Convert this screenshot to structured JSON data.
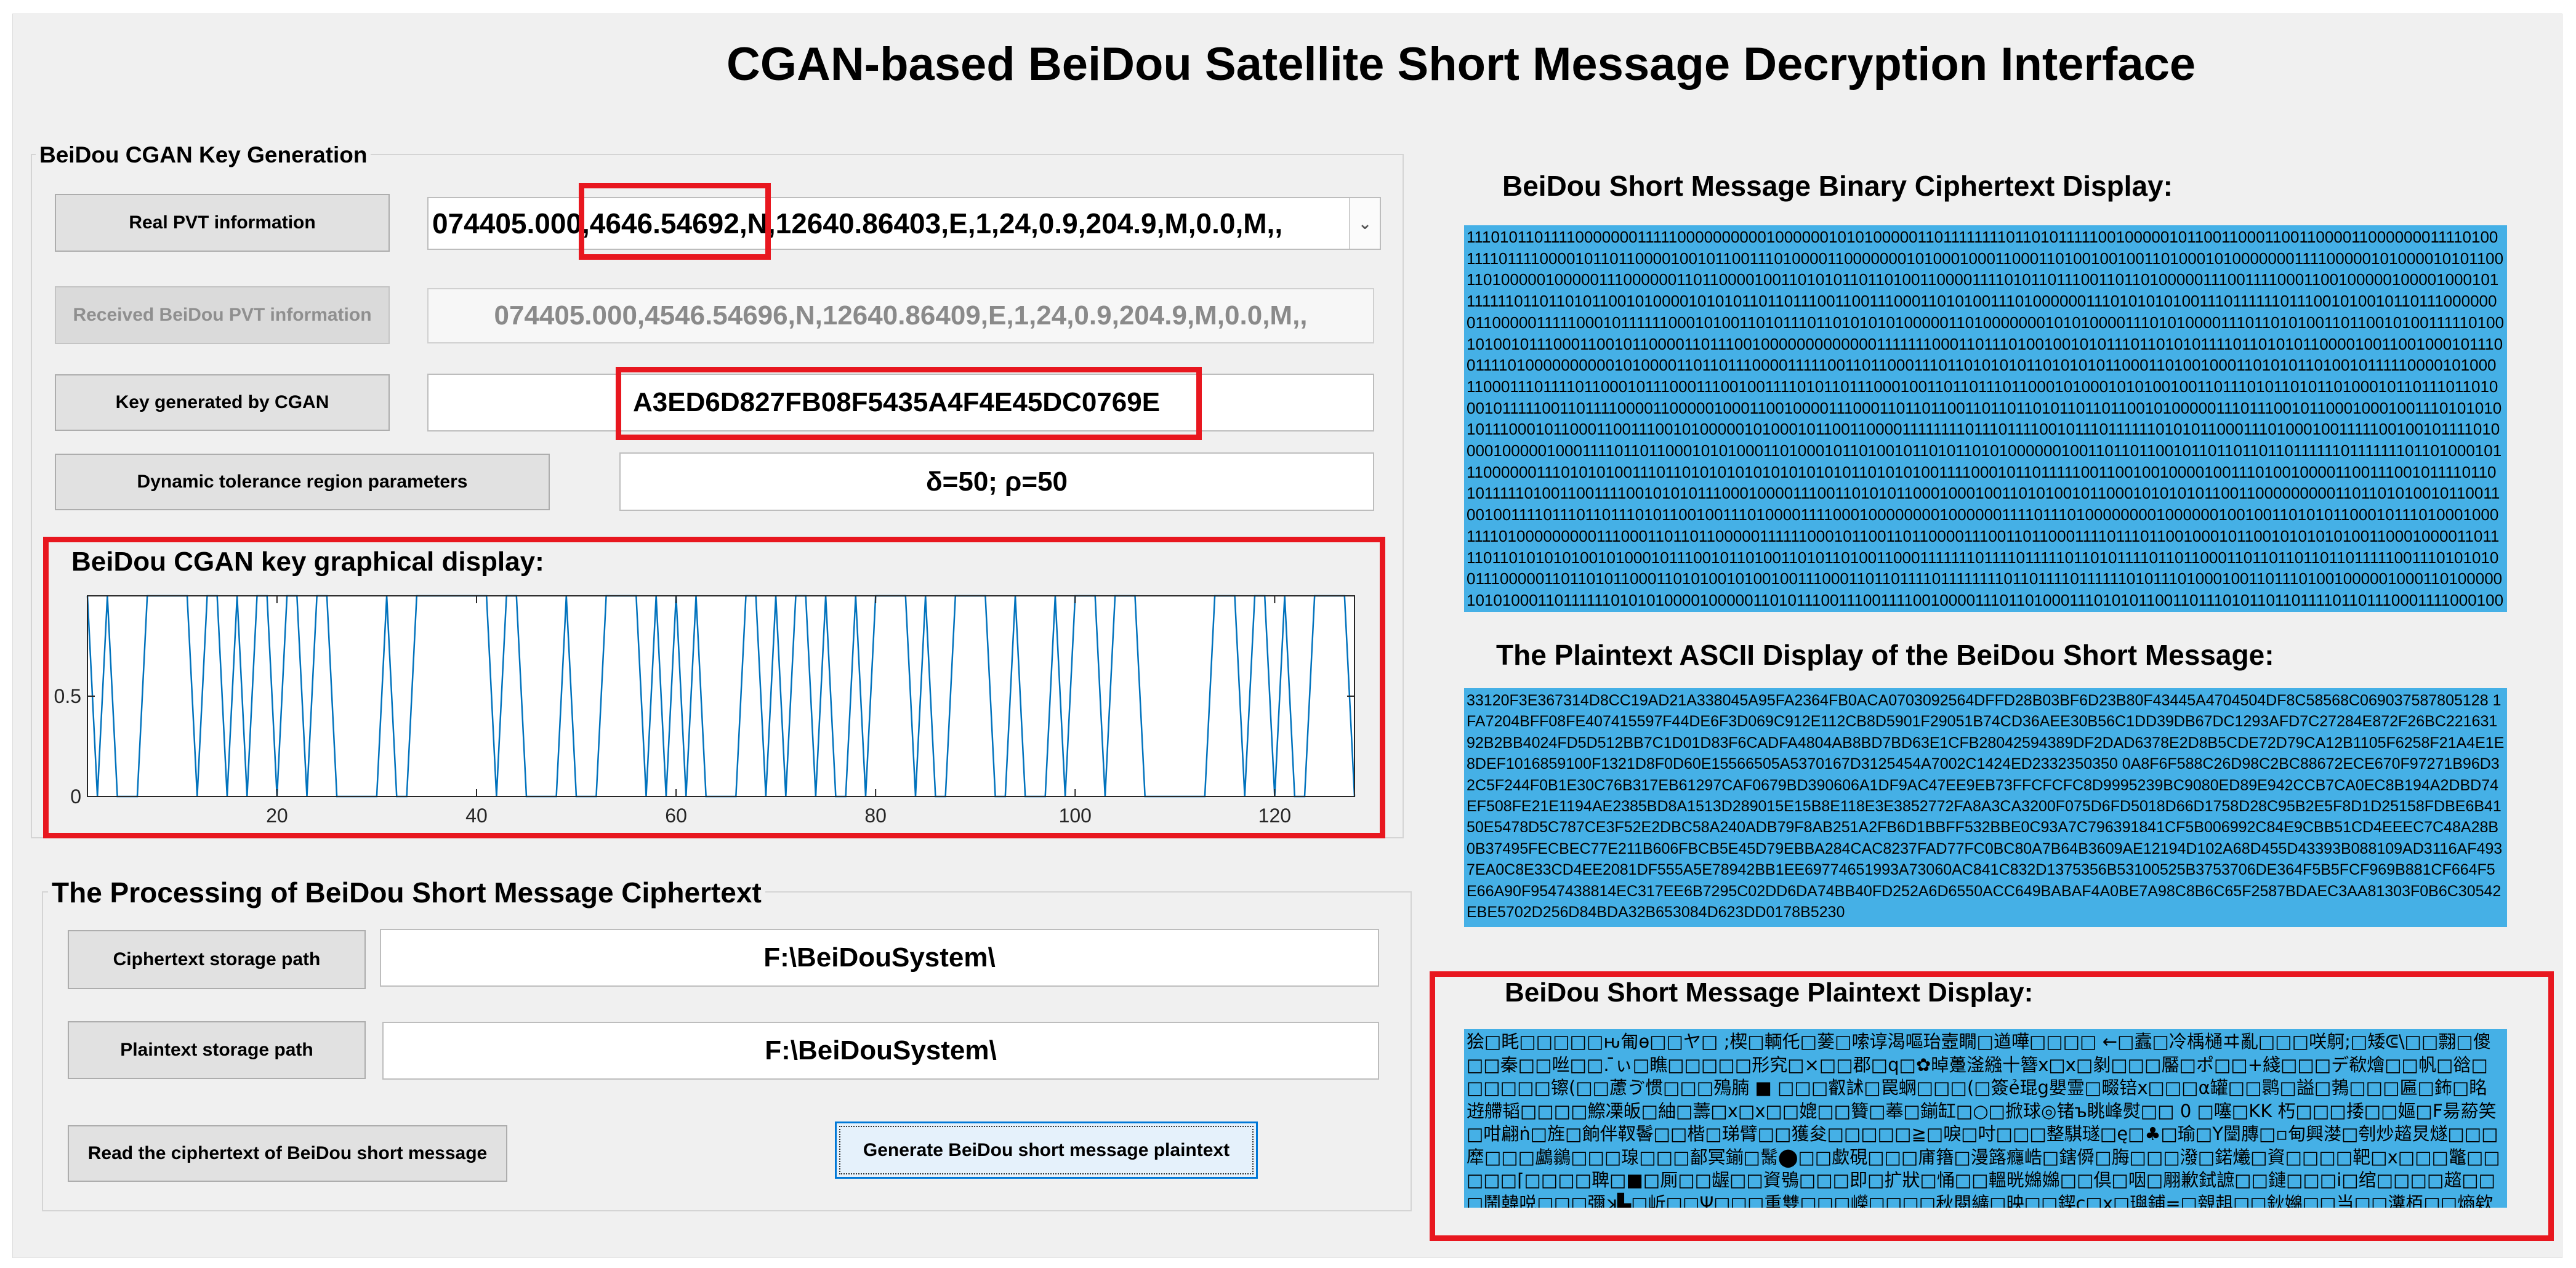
{
  "title": "CGAN-based BeiDou Satellite Short Message Decryption Interface",
  "key_generation": {
    "panel_title": "BeiDou CGAN Key Generation",
    "real_pvt_button": "Real PVT information",
    "real_pvt_value": "074405.000,4646.54692,N,12640.86403,E,1,24,0.9,204.9,M,0.0,M,,",
    "received_pvt_button": "Received BeiDou PVT information",
    "received_pvt_value": "074405.000,4546.54696,N,12640.86409,E,1,24,0.9,204.9,M,0.0,M,,",
    "key_button": "Key generated by CGAN",
    "key_value": "A3ED6D827FB08F5435A4F4E45DC0769E",
    "tolerance_button": "Dynamic tolerance region parameters",
    "tolerance_value": "δ=50; ρ=50"
  },
  "key_plot": {
    "title": "BeiDou CGAN key graphical display:"
  },
  "chart_data": {
    "type": "line",
    "title": "BeiDou CGAN key graphical display:",
    "xlabel": "",
    "ylabel": "",
    "xlim": [
      1,
      128
    ],
    "ylim": [
      0,
      1
    ],
    "xticks": [
      20,
      40,
      60,
      80,
      100,
      120
    ],
    "yticks": [
      0,
      0.5
    ],
    "ytick_labels": [
      "0",
      "0.5"
    ],
    "color": "#0072bd",
    "grid": false,
    "key_hex": "A3ED6D827FB08F5435A4F4E45DC0769E",
    "x": [
      1,
      2,
      3,
      4,
      5,
      6,
      7,
      8,
      9,
      10,
      11,
      12,
      13,
      14,
      15,
      16,
      17,
      18,
      19,
      20,
      21,
      22,
      23,
      24,
      25,
      26,
      27,
      28,
      29,
      30,
      31,
      32,
      33,
      34,
      35,
      36,
      37,
      38,
      39,
      40,
      41,
      42,
      43,
      44,
      45,
      46,
      47,
      48,
      49,
      50,
      51,
      52,
      53,
      54,
      55,
      56,
      57,
      58,
      59,
      60,
      61,
      62,
      63,
      64,
      65,
      66,
      67,
      68,
      69,
      70,
      71,
      72,
      73,
      74,
      75,
      76,
      77,
      78,
      79,
      80,
      81,
      82,
      83,
      84,
      85,
      86,
      87,
      88,
      89,
      90,
      91,
      92,
      93,
      94,
      95,
      96,
      97,
      98,
      99,
      100,
      101,
      102,
      103,
      104,
      105,
      106,
      107,
      108,
      109,
      110,
      111,
      112,
      113,
      114,
      115,
      116,
      117,
      118,
      119,
      120,
      121,
      122,
      123,
      124,
      125,
      126,
      127,
      128
    ],
    "values": [
      1,
      0,
      1,
      0,
      0,
      0,
      1,
      1,
      1,
      1,
      1,
      0,
      1,
      1,
      0,
      1,
      0,
      1,
      1,
      0,
      1,
      1,
      0,
      1,
      1,
      0,
      0,
      0,
      0,
      0,
      1,
      0,
      0,
      1,
      1,
      1,
      1,
      1,
      1,
      1,
      1,
      0,
      1,
      1,
      0,
      0,
      0,
      0,
      1,
      0,
      0,
      0,
      1,
      1,
      1,
      1,
      0,
      1,
      0,
      1,
      0,
      1,
      0,
      0,
      0,
      0,
      1,
      1,
      0,
      1,
      0,
      1,
      1,
      0,
      1,
      0,
      0,
      1,
      0,
      1,
      1,
      1,
      1,
      0,
      1,
      0,
      0,
      1,
      1,
      1,
      1,
      0,
      0,
      1,
      0,
      0,
      0,
      1,
      0,
      1,
      1,
      1,
      0,
      1,
      1,
      1,
      0,
      0,
      0,
      0,
      0,
      0,
      0,
      1,
      1,
      1,
      0,
      1,
      1,
      0,
      1,
      0,
      0,
      1,
      1,
      1,
      1,
      0
    ]
  },
  "processing": {
    "panel_title": "The Processing of BeiDou Short Message Ciphertext",
    "cipher_path_button": "Ciphertext storage path",
    "cipher_path_value": "F:\\BeiDouSystem\\",
    "plain_path_button": "Plaintext storage path",
    "plain_path_value": "F:\\BeiDouSystem\\",
    "read_button": "Read the ciphertext of BeiDou short message",
    "generate_button": "Generate BeiDou short message plaintext"
  },
  "binary_display": {
    "title": "BeiDou Short Message Binary Ciphertext Display:",
    "text": "1110101101111000000011111000000000010000001010100000110111111110110101111100100000101100110001100110000110000000111101001111011110000101101100001001011001110100001100000001010001000110001101001001001101000101000000011110000010100001010110011010000010000011100000011011000010011010101101101001100001111010110111001101101000001110011110001100100000100001000101111111011011010110010100001010101101101110011001110001101010011101000000111010101010011101111110111001010010110111000000011000001111100010111111000101001101011101101010101000001101000000010101000011101010000111011010100110110010100111110100101001011100011001011000011011100100000000000001111111000110111010010010101110110101011110110101011000010011001000101110011110100000000001010000110110111000011111001101100011101101010101101010101100011010010001101010110100101111100001010001100011101111011000101110001110010011110101101110001001101101110110001010001010100100110111010110101101000101101110110100010111110011011110000110000010001100100001110001101101100110110110101101101100101000001110111001011000100010011101010101011100010110001100111001010000010100010110011000011111111011101111001011101111110101011000111010001001111100100101111010000100000100011110110110001010100011010001011010010110101101010000001001101101100101101101101101111110111111101101000101110000001110101010011101101010101010101010101101010100111100010110111110011001001000010011101001000011001110010111101101011111010011001111001010101110001000011100110101011000100010011010100101100010101010110011000000000110110101001011001100100111101110110111010110010011101000011110001000000001000000111101110100000000100000010010011010101100010111010001000111101000000000111000110110110000011111100010110011011000011100110110001111011101100100010110010101010100110001000011011110110101010100101000101110010110100110101101001100011111110111101111101101011110110110001101101101101101111100111010101001110000011011010110001101010010100100111000110110111101111111101101111011111101011101000100110111010010000010001101000001010100011011111101010100001000001101011100111001111001000011101101000111010101100110111010110110111101101110001111000100011100100001001001100110100000111110100011011010101011010001110110011010100101110101010011101110100101110110011011000101101111101101011100011011011010001110011101111100110101000111110110111000010101111111100110101010110100111011100111100000111101100000001001101010111010101111101010110110011111011010111101010101100101101010100100110101111110000111011111000110101011101001101110101111011101100010110000101101101100110110111111101011000111010010101110110011101100101001101110101001111100111011111101000010100011101100101110111010101101100100000101100101111101101010010100101110110101011111101010101100111000101011011001010101100111100101010011110101111000101110111101110011110000110011001011110111010101110110100110111011101110011001010101111011101"
  },
  "ascii_display": {
    "title": "The  Plaintext ASCII Display of the BeiDou Short Message:",
    "text": "33120F3E367314D8CC19AD21A338045A95FA2364FB0ACA0703092564DFFD28B03BF6D23B80F43445A4704504DF8C58568C069037587805128 1FA7204BFF08FE407415597F44DE6F3D069C912E112CB8D5901F29051B74CD36AEE30B56C1DD39DB67DC1293AFD7C27284E872F26BC22163192B2BB4024FD5D512BB7C1D01D83F6CADFA4804AB8BD7BD63E1CFB28042594389DF2DAD6378E2D8B5CDE72D79CA12B1105F6258F21A4E1E8DEF1016859100F1321D8F0D60E15566505A5370167D3125454A7002C1424ED2332350350 0A8F6F588C26D98C2BC88672ECE670F97271B96D32C5F244F0B1E30C76B317EB61297CAF0679BD390606A1DF9AC47EE9EB73FFCFCFC8D9995239BC9080ED89E942CCB7CA0EC8B194A2DBD74EF508FE21E1194AE2385BD8A1513D289015E15B8E118E3E3852772FA8A3CA3200F075D6FD5018D66D1758D28C95B2E5F8D1D25158FDBE6B4150E5478D5C787CE3F52E2DBC58A240ADB79F8AB251A2FB6D1BBFF532BBE0C93A7C796391841CF5B006992C84E9CBB51CD4EEEC7C48A28B0B37495FECBEC77E211B606FBCB5E45D79EBBA284CAC8237FAD77FC0BC80A7B64B3609AE12194D102A68D455D43393B088109AD3116AF4937EA0C8E33CD4EE2081DF555A5E78942BB1EE69774651993A73060AC841C832D1375356B53100525B3753706DE364F5B5FCF969B881CF664F5E66A90F9547438814EC317EE6B7295C02DD6DA74BB40FD252A6D6550ACC649BABAF4A0BE7A98C8B6C65F2587BDAEC3AA81303F0B6C30542EBE5702D256D84BDA32B653084D623DD0178B5230"
  },
  "plaintext_display": {
    "title": "BeiDou Short Message Plaintext Display:",
    "text": "狯□眊□□□□□ԋ匍ѳ□□ヤ□ ;楔□輌仛□蓌□嗦谆渴嘔珆壼瞯□遒嘩□□□□ ←□蠧□冷楀樋ヰ亂□□□咲鴚;□矮ᕳ\\□□翲□傻□□秦□□咝□□. ̄ぃ□瞧□□□□□形究□×□□郡□q□✿晫躉滏繈十簪ⅹ□ⅹ□剶□□□靨□ポ□□+綫□□□デ欷燴□□帆□谽□□□□□□镲(□□藘ゔ惯□□□殦腩 ■ □□□叡訹□罠蛧□□□(□簽ẻ琨g嬰霊□畷锫ⅹ□□□α罐□□鹮□謚□鵓□□□匾□鈽□眳逰艜韬□□□□鰶凓皈□紬□薵□ⅹ□ⅹ□□媲□□籫□菶□鎆缸□○□掀球◎锗ъ眺峰熨□□ 0 □噻□KK 朽□□□捼□□嫗□F昜蒶笑□咁翩ṅ□旌□餉伴靫鬠□□楷□珶臂□□獲夋□□□□□≧□唳□吋□□□整騏璲□ę□♣□瑜□Y闛膞□▫甸興漤□刳炒趦炅燧□□□犘□□□鸕鶲□□□瑔□□□鄐冥鎆□鬗⬤□□歔硯□□□庯簎□漫簬癮峼□鎋僢□脢□□□潑□鍩爔□資□□□□靶□ⅹ□□□鼈□□□□□⌈□□□□聛□■□厠□□龌□□資鴞□□□即□扩狀□悀□□轀晄嬵嬵□□倶□咽□翢歉鉽謶□□鏈□□□i□绾□□□□趦□□□鬧韓哾□□□彌ʞ▙□岓□□Ψ□□□重雙□□□嶸□□□□秋閱纊□映□□鍥ⅽ□ⅹ□璵鋪=□覫趄□□鈥嬵□□当□□瀵栢□□熵欸□□疃□鰓巖棚∓□□□玲燛杭¥殥才稹□□菖□□□□□□ⓠ翲"
  }
}
